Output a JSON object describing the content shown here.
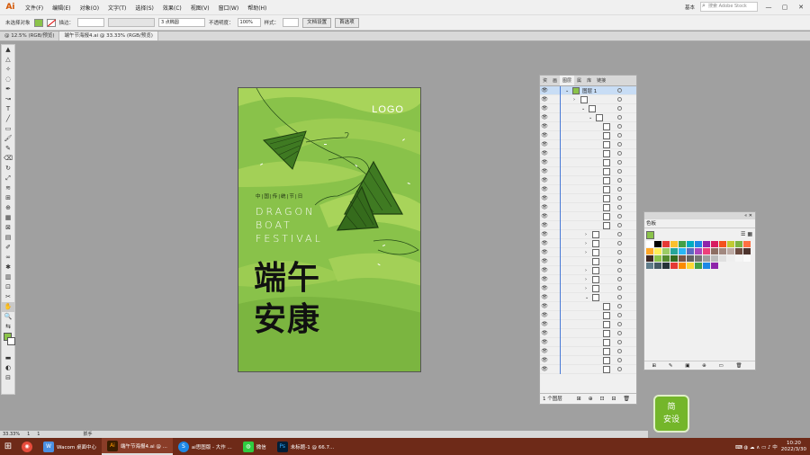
{
  "app": {
    "logo": "Ai"
  },
  "menu": [
    "文件(F)",
    "编辑(E)",
    "对象(O)",
    "文字(T)",
    "选择(S)",
    "效果(C)",
    "视图(V)",
    "窗口(W)",
    "帮助(H)"
  ],
  "menu_right": {
    "workspace": "基本",
    "search_placeholder": "搜索 Adobe Stock"
  },
  "control": {
    "selection": "未选择对象",
    "stroke_label": "描边：",
    "brush": "3 点椭圆",
    "opacity_label": "不透明度：",
    "opacity": "100%",
    "style_label": "样式：",
    "doc_setup": "文档设置",
    "prefs": "首选项"
  },
  "tabs": [
    {
      "label": "@ 12.5% (RGB/预览)",
      "active": false
    },
    {
      "label": "端午节海报4.ai @ 33.33% (RGB/预览)",
      "active": true
    }
  ],
  "artboard": {
    "logo": "LOGO",
    "cn_small": "中|国|传|统|节|日",
    "en1": "DRAGON",
    "en2": "BOAT",
    "en3": "FESTIVAL",
    "cn1": "端午",
    "cn2": "安康",
    "bg_color": "#89c24a"
  },
  "layers_panel": {
    "tabs": [
      "资",
      "画",
      "图层",
      "属",
      "库",
      "链接"
    ],
    "layer_name": "图层 1",
    "footer": "1 个图层"
  },
  "swatch_panel": {
    "title": "色板"
  },
  "badge": {
    "line1": "简",
    "line2": "安设"
  },
  "status": {
    "zoom": "33.33%",
    "page": "1",
    "tool": "抓手"
  },
  "taskbar": {
    "items": [
      {
        "label": "Wacom 桌面中心"
      },
      {
        "label": "端午节海报4.ai @ ..."
      },
      {
        "label": "ai思图版 - 大作 ..."
      },
      {
        "label": "微信"
      },
      {
        "label": "未标题-1 @ 66.7..."
      }
    ],
    "time": "10:20",
    "date": "2022/3/30"
  }
}
